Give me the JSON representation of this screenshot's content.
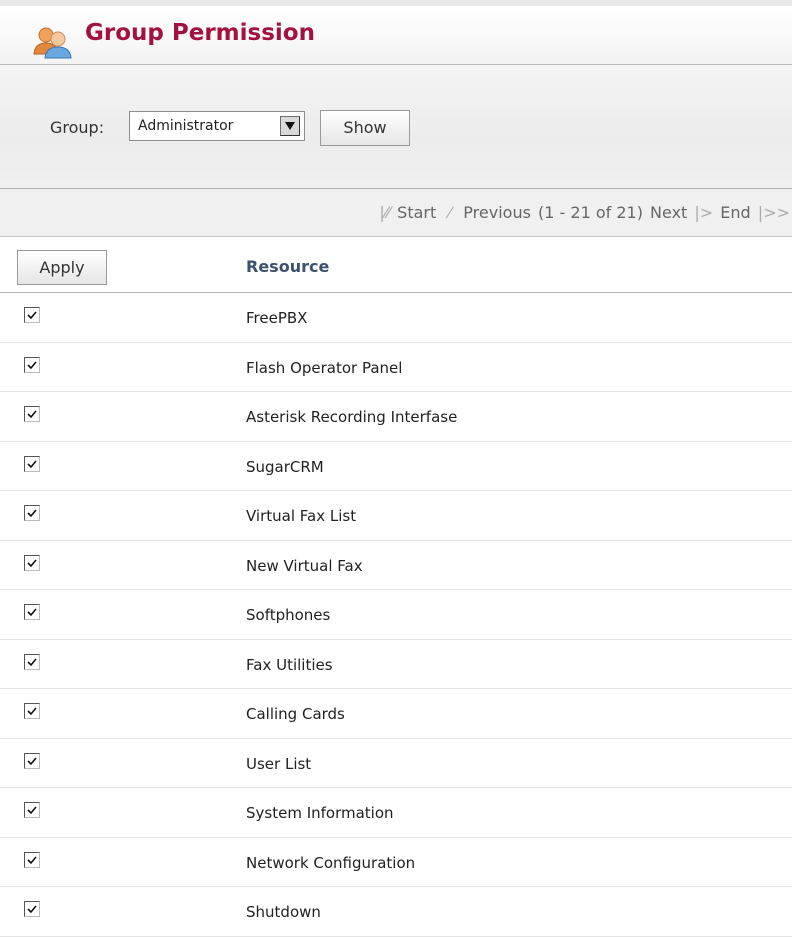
{
  "header": {
    "title": "Group Permission",
    "icon": "users-group-icon"
  },
  "filter": {
    "group_label": "Group:",
    "group_selected": "Administrator",
    "show_label": "Show"
  },
  "pagination": {
    "start": "Start",
    "previous": "Previous",
    "range": "(1 - 21 of 21)",
    "next": "Next",
    "end": "End"
  },
  "table": {
    "apply_label": "Apply",
    "resource_header": "Resource",
    "rows": [
      {
        "name": "FreePBX",
        "checked": true
      },
      {
        "name": "Flash Operator Panel",
        "checked": true
      },
      {
        "name": "Asterisk Recording Interfase",
        "checked": true
      },
      {
        "name": "SugarCRM",
        "checked": true
      },
      {
        "name": "Virtual Fax List",
        "checked": true
      },
      {
        "name": "New Virtual Fax",
        "checked": true
      },
      {
        "name": "Softphones",
        "checked": true
      },
      {
        "name": "Fax Utilities",
        "checked": true
      },
      {
        "name": "Calling Cards",
        "checked": true
      },
      {
        "name": "User List",
        "checked": true
      },
      {
        "name": "System Information",
        "checked": true
      },
      {
        "name": "Network Configuration",
        "checked": true
      },
      {
        "name": "Shutdown",
        "checked": true
      }
    ]
  },
  "colors": {
    "title": "#a3123f",
    "resource_header": "#3a5170"
  }
}
